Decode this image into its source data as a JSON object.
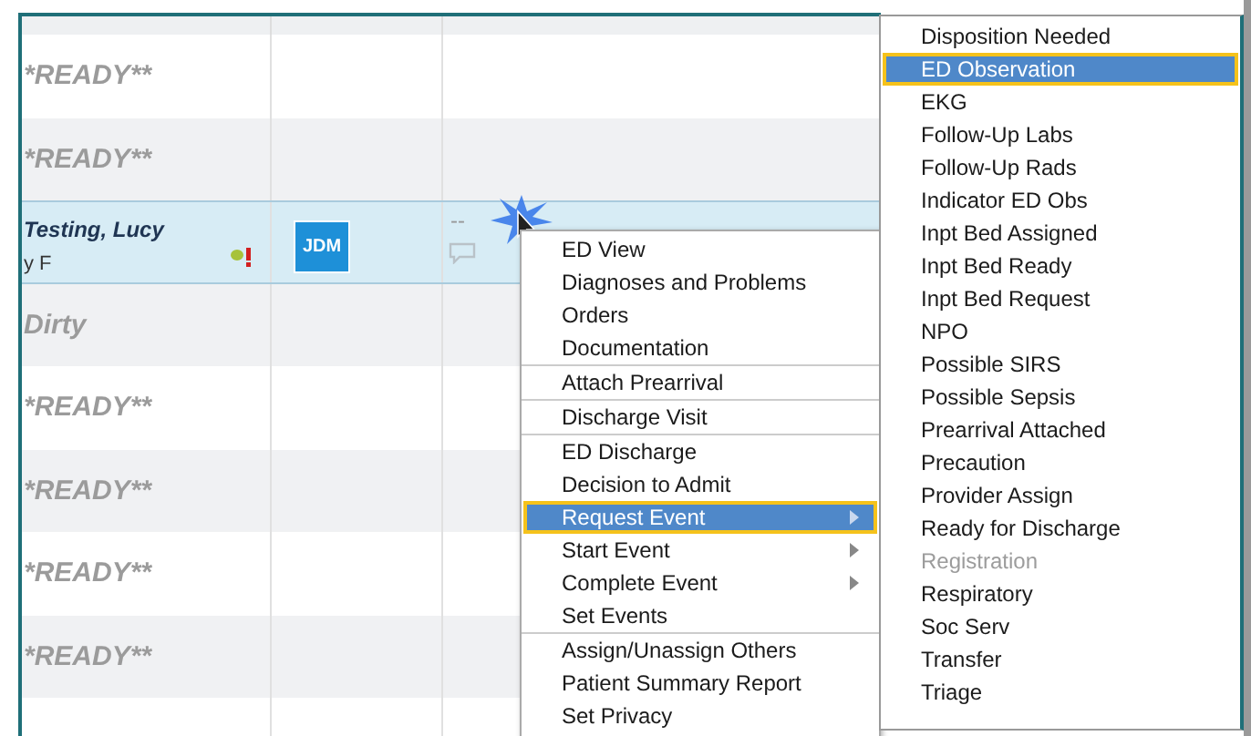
{
  "table": {
    "rows": [
      {
        "kind": "status",
        "text": "*READY**",
        "selected": false
      },
      {
        "kind": "status",
        "text": "*READY**",
        "selected": false
      },
      {
        "kind": "patient",
        "name": "Testing, Lucy",
        "detail": "y F",
        "provider": "JDM",
        "column_3": "--",
        "selected": true
      },
      {
        "kind": "status",
        "text": "Dirty",
        "selected": false
      },
      {
        "kind": "status",
        "text": "*READY**",
        "selected": false
      },
      {
        "kind": "status",
        "text": "*READY**",
        "selected": false
      },
      {
        "kind": "status",
        "text": "*READY**",
        "selected": false
      },
      {
        "kind": "status",
        "text": "*READY**",
        "selected": false
      },
      {
        "kind": "status",
        "text": "",
        "selected": false
      }
    ]
  },
  "context_menu": {
    "groups": [
      [
        {
          "label": "ED View",
          "submenu": false,
          "selected": false
        },
        {
          "label": "Diagnoses and Problems",
          "submenu": false,
          "selected": false
        },
        {
          "label": "Orders",
          "submenu": false,
          "selected": false
        },
        {
          "label": "Documentation",
          "submenu": false,
          "selected": false
        }
      ],
      [
        {
          "label": "Attach Prearrival",
          "submenu": false,
          "selected": false
        }
      ],
      [
        {
          "label": "Discharge Visit",
          "submenu": false,
          "selected": false
        }
      ],
      [
        {
          "label": "ED Discharge",
          "submenu": false,
          "selected": false
        },
        {
          "label": "Decision to Admit",
          "submenu": false,
          "selected": false
        },
        {
          "label": "Request Event",
          "submenu": true,
          "selected": true
        },
        {
          "label": "Start Event",
          "submenu": true,
          "selected": false
        },
        {
          "label": "Complete Event",
          "submenu": true,
          "selected": false
        },
        {
          "label": "Set Events",
          "submenu": false,
          "selected": false
        }
      ],
      [
        {
          "label": "Assign/Unassign Others",
          "submenu": false,
          "selected": false
        },
        {
          "label": "Patient Summary Report",
          "submenu": false,
          "selected": false
        },
        {
          "label": "Set Privacy",
          "submenu": false,
          "selected": false
        }
      ]
    ]
  },
  "submenu": {
    "items": [
      {
        "label": "Disposition Needed",
        "selected": false,
        "disabled": false
      },
      {
        "label": "ED Observation",
        "selected": true,
        "disabled": false
      },
      {
        "label": "EKG",
        "selected": false,
        "disabled": false
      },
      {
        "label": "Follow-Up Labs",
        "selected": false,
        "disabled": false
      },
      {
        "label": "Follow-Up Rads",
        "selected": false,
        "disabled": false
      },
      {
        "label": "Indicator ED Obs",
        "selected": false,
        "disabled": false
      },
      {
        "label": "Inpt Bed Assigned",
        "selected": false,
        "disabled": false
      },
      {
        "label": "Inpt Bed Ready",
        "selected": false,
        "disabled": false
      },
      {
        "label": "Inpt Bed Request",
        "selected": false,
        "disabled": false
      },
      {
        "label": "NPO",
        "selected": false,
        "disabled": false
      },
      {
        "label": "Possible SIRS",
        "selected": false,
        "disabled": false
      },
      {
        "label": "Possible Sepsis",
        "selected": false,
        "disabled": false
      },
      {
        "label": "Prearrival Attached",
        "selected": false,
        "disabled": false
      },
      {
        "label": "Precaution",
        "selected": false,
        "disabled": false
      },
      {
        "label": "Provider Assign",
        "selected": false,
        "disabled": false
      },
      {
        "label": "Ready for Discharge",
        "selected": false,
        "disabled": false
      },
      {
        "label": "Registration",
        "selected": false,
        "disabled": true
      },
      {
        "label": "Respiratory",
        "selected": false,
        "disabled": false
      },
      {
        "label": "Soc Serv",
        "selected": false,
        "disabled": false
      },
      {
        "label": "Transfer",
        "selected": false,
        "disabled": false
      },
      {
        "label": "Triage",
        "selected": false,
        "disabled": false
      }
    ]
  }
}
